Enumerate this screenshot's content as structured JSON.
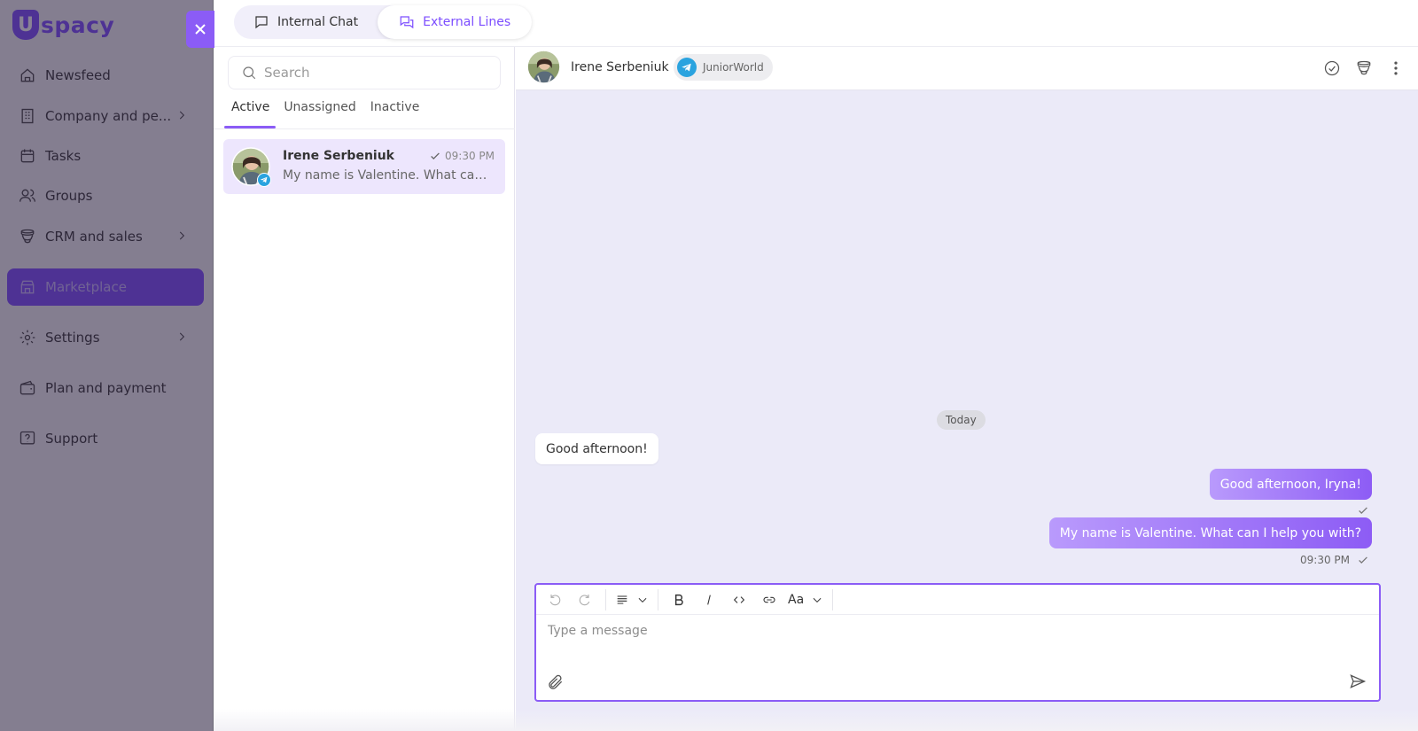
{
  "app": {
    "logo_letter": "U",
    "logo_text": "spacy"
  },
  "nav": {
    "items": [
      {
        "label": "Newsfeed",
        "icon": "home-icon"
      },
      {
        "label": "Company and pe...",
        "icon": "building-icon"
      },
      {
        "label": "Tasks",
        "icon": "calendar-icon"
      },
      {
        "label": "Groups",
        "icon": "users-icon"
      },
      {
        "label": "CRM and sales",
        "icon": "funnel-icon"
      },
      {
        "label": "Marketplace",
        "icon": "store-icon"
      },
      {
        "label": "Settings",
        "icon": "gear-icon"
      },
      {
        "label": "Plan and payment",
        "icon": "wallet-icon"
      },
      {
        "label": "Support",
        "icon": "help-icon"
      }
    ],
    "active": "Marketplace"
  },
  "top_tabs": {
    "internal": "Internal Chat",
    "external": "External Lines",
    "selected": "External Lines"
  },
  "search": {
    "placeholder": "Search",
    "value": ""
  },
  "list_tabs": {
    "active": "Active",
    "unassigned": "Unassigned",
    "inactive": "Inactive",
    "selected": "Active"
  },
  "conversations": [
    {
      "name": "Irene Serbeniuk",
      "time": "09:30 PM",
      "preview": "My name is Valentine. What can I help you with?",
      "channel_icon": "telegram-icon"
    }
  ],
  "chat": {
    "contact_name": "Irene Serbeniuk",
    "channel_name": "JuniorWorld",
    "day_label": "Today",
    "messages": [
      {
        "direction": "in",
        "text": "Good afternoon!"
      },
      {
        "direction": "out",
        "text": "Good afternoon, Iryna!"
      },
      {
        "direction": "out",
        "text": "My name is Valentine. What can I help you with?"
      }
    ],
    "last_time": "09:30 PM"
  },
  "composer": {
    "placeholder": "Type a message",
    "value": "",
    "font_label": "Aa"
  },
  "colors": {
    "accent": "#8b5cf6",
    "accent_light": "#ede6fd",
    "chat_bg": "#ebeaf8",
    "telegram": "#2aa3df"
  }
}
